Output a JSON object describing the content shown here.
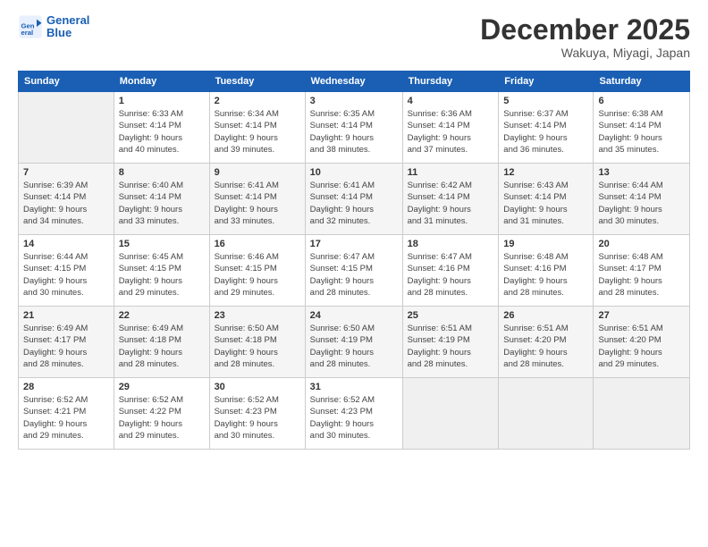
{
  "header": {
    "logo_line1": "General",
    "logo_line2": "Blue",
    "month": "December 2025",
    "location": "Wakuya, Miyagi, Japan"
  },
  "weekdays": [
    "Sunday",
    "Monday",
    "Tuesday",
    "Wednesday",
    "Thursday",
    "Friday",
    "Saturday"
  ],
  "weeks": [
    [
      {
        "day": "",
        "info": ""
      },
      {
        "day": "1",
        "info": "Sunrise: 6:33 AM\nSunset: 4:14 PM\nDaylight: 9 hours\nand 40 minutes."
      },
      {
        "day": "2",
        "info": "Sunrise: 6:34 AM\nSunset: 4:14 PM\nDaylight: 9 hours\nand 39 minutes."
      },
      {
        "day": "3",
        "info": "Sunrise: 6:35 AM\nSunset: 4:14 PM\nDaylight: 9 hours\nand 38 minutes."
      },
      {
        "day": "4",
        "info": "Sunrise: 6:36 AM\nSunset: 4:14 PM\nDaylight: 9 hours\nand 37 minutes."
      },
      {
        "day": "5",
        "info": "Sunrise: 6:37 AM\nSunset: 4:14 PM\nDaylight: 9 hours\nand 36 minutes."
      },
      {
        "day": "6",
        "info": "Sunrise: 6:38 AM\nSunset: 4:14 PM\nDaylight: 9 hours\nand 35 minutes."
      }
    ],
    [
      {
        "day": "7",
        "info": "Sunrise: 6:39 AM\nSunset: 4:14 PM\nDaylight: 9 hours\nand 34 minutes."
      },
      {
        "day": "8",
        "info": "Sunrise: 6:40 AM\nSunset: 4:14 PM\nDaylight: 9 hours\nand 33 minutes."
      },
      {
        "day": "9",
        "info": "Sunrise: 6:41 AM\nSunset: 4:14 PM\nDaylight: 9 hours\nand 33 minutes."
      },
      {
        "day": "10",
        "info": "Sunrise: 6:41 AM\nSunset: 4:14 PM\nDaylight: 9 hours\nand 32 minutes."
      },
      {
        "day": "11",
        "info": "Sunrise: 6:42 AM\nSunset: 4:14 PM\nDaylight: 9 hours\nand 31 minutes."
      },
      {
        "day": "12",
        "info": "Sunrise: 6:43 AM\nSunset: 4:14 PM\nDaylight: 9 hours\nand 31 minutes."
      },
      {
        "day": "13",
        "info": "Sunrise: 6:44 AM\nSunset: 4:14 PM\nDaylight: 9 hours\nand 30 minutes."
      }
    ],
    [
      {
        "day": "14",
        "info": "Sunrise: 6:44 AM\nSunset: 4:15 PM\nDaylight: 9 hours\nand 30 minutes."
      },
      {
        "day": "15",
        "info": "Sunrise: 6:45 AM\nSunset: 4:15 PM\nDaylight: 9 hours\nand 29 minutes."
      },
      {
        "day": "16",
        "info": "Sunrise: 6:46 AM\nSunset: 4:15 PM\nDaylight: 9 hours\nand 29 minutes."
      },
      {
        "day": "17",
        "info": "Sunrise: 6:47 AM\nSunset: 4:15 PM\nDaylight: 9 hours\nand 28 minutes."
      },
      {
        "day": "18",
        "info": "Sunrise: 6:47 AM\nSunset: 4:16 PM\nDaylight: 9 hours\nand 28 minutes."
      },
      {
        "day": "19",
        "info": "Sunrise: 6:48 AM\nSunset: 4:16 PM\nDaylight: 9 hours\nand 28 minutes."
      },
      {
        "day": "20",
        "info": "Sunrise: 6:48 AM\nSunset: 4:17 PM\nDaylight: 9 hours\nand 28 minutes."
      }
    ],
    [
      {
        "day": "21",
        "info": "Sunrise: 6:49 AM\nSunset: 4:17 PM\nDaylight: 9 hours\nand 28 minutes."
      },
      {
        "day": "22",
        "info": "Sunrise: 6:49 AM\nSunset: 4:18 PM\nDaylight: 9 hours\nand 28 minutes."
      },
      {
        "day": "23",
        "info": "Sunrise: 6:50 AM\nSunset: 4:18 PM\nDaylight: 9 hours\nand 28 minutes."
      },
      {
        "day": "24",
        "info": "Sunrise: 6:50 AM\nSunset: 4:19 PM\nDaylight: 9 hours\nand 28 minutes."
      },
      {
        "day": "25",
        "info": "Sunrise: 6:51 AM\nSunset: 4:19 PM\nDaylight: 9 hours\nand 28 minutes."
      },
      {
        "day": "26",
        "info": "Sunrise: 6:51 AM\nSunset: 4:20 PM\nDaylight: 9 hours\nand 28 minutes."
      },
      {
        "day": "27",
        "info": "Sunrise: 6:51 AM\nSunset: 4:20 PM\nDaylight: 9 hours\nand 29 minutes."
      }
    ],
    [
      {
        "day": "28",
        "info": "Sunrise: 6:52 AM\nSunset: 4:21 PM\nDaylight: 9 hours\nand 29 minutes."
      },
      {
        "day": "29",
        "info": "Sunrise: 6:52 AM\nSunset: 4:22 PM\nDaylight: 9 hours\nand 29 minutes."
      },
      {
        "day": "30",
        "info": "Sunrise: 6:52 AM\nSunset: 4:23 PM\nDaylight: 9 hours\nand 30 minutes."
      },
      {
        "day": "31",
        "info": "Sunrise: 6:52 AM\nSunset: 4:23 PM\nDaylight: 9 hours\nand 30 minutes."
      },
      {
        "day": "",
        "info": ""
      },
      {
        "day": "",
        "info": ""
      },
      {
        "day": "",
        "info": ""
      }
    ]
  ]
}
